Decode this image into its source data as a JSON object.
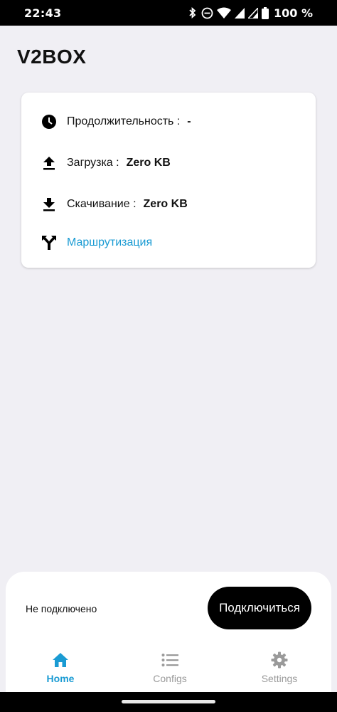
{
  "status_bar": {
    "time": "22:43",
    "battery": "100 %"
  },
  "app": {
    "title": "V2BOX"
  },
  "stats": {
    "duration": {
      "label": "Продолжительность :",
      "value": "-",
      "icon": "clock-icon"
    },
    "upload": {
      "label": "Загрузка :",
      "value": "Zero KB",
      "icon": "upload-icon"
    },
    "download": {
      "label": "Скачивание :",
      "value": "Zero KB",
      "icon": "download-icon"
    },
    "routing": {
      "label": "Маршрутизация",
      "icon": "routing-icon"
    }
  },
  "connection": {
    "status": "Не подключено",
    "button_label": "Подключиться"
  },
  "nav": {
    "items": [
      {
        "label": "Home",
        "icon": "home-icon",
        "active": true
      },
      {
        "label": "Configs",
        "icon": "list-icon",
        "active": false
      },
      {
        "label": "Settings",
        "icon": "gear-icon",
        "active": false
      }
    ]
  },
  "colors": {
    "accent": "#1a9bd3",
    "background": "#f0eff4",
    "inactive": "#9a9a9a"
  }
}
